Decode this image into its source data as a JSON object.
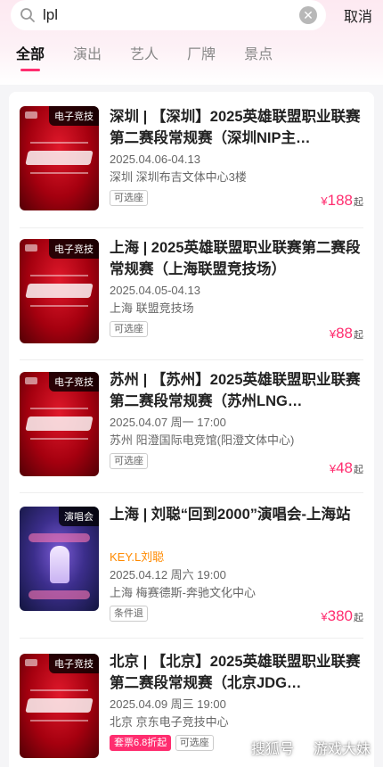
{
  "search": {
    "value": "lpl",
    "cancel_label": "取消"
  },
  "tabs": [
    {
      "label": "全部",
      "active": true
    },
    {
      "label": "演出",
      "active": false
    },
    {
      "label": "艺人",
      "active": false
    },
    {
      "label": "厂牌",
      "active": false
    },
    {
      "label": "景点",
      "active": false
    }
  ],
  "events": [
    {
      "poster_tag": "电子竞技",
      "title": "深圳 | 【深圳】2025英雄联盟职业联赛第二赛段常规赛（深圳NIP主…",
      "date": "2025.04.06-04.13",
      "venue": "深圳  深圳布吉文体中心3楼",
      "chips": [
        "可选座"
      ],
      "price_symbol": "¥",
      "price": "188",
      "price_suffix": "起"
    },
    {
      "poster_tag": "电子竞技",
      "title": "上海 | 2025英雄联盟职业联赛第二赛段常规赛（上海联盟竞技场）",
      "date": "2025.04.05-04.13",
      "venue": "上海  联盟竞技场",
      "chips": [
        "可选座"
      ],
      "price_symbol": "¥",
      "price": "88",
      "price_suffix": "起"
    },
    {
      "poster_tag": "电子竞技",
      "title": "苏州 | 【苏州】2025英雄联盟职业联赛第二赛段常规赛（苏州LNG…",
      "date": "2025.04.07 周一 17:00",
      "venue": "苏州  阳澄国际电竞馆(阳澄文体中心)",
      "chips": [
        "可选座"
      ],
      "price_symbol": "¥",
      "price": "48",
      "price_suffix": "起"
    },
    {
      "poster_tag": "演唱会",
      "title": "上海 | 刘聪“回到2000”演唱会-上海站",
      "artist": "KEY.L刘聪",
      "date": "2025.04.12 周六 19:00",
      "venue": "上海  梅赛德斯-奔驰文化中心",
      "chips": [
        "条件退"
      ],
      "price_symbol": "¥",
      "price": "380",
      "price_suffix": "起"
    },
    {
      "poster_tag": "电子竞技",
      "title": "北京 | 【北京】2025英雄联盟职业联赛第二赛段常规赛（北京JDG…",
      "date": "2025.04.09 周三 19:00",
      "venue": "北京  京东电子竞技中心",
      "chips": [
        "套票6.8折起",
        "可选座"
      ]
    }
  ],
  "watermark": {
    "prefix": "搜狐号",
    "suffix": "游戏大妹"
  }
}
